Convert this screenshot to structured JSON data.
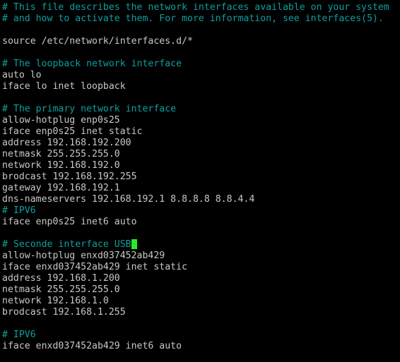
{
  "terminal": {
    "background_color": "#000000",
    "comment_color": "#0f9f9f",
    "text_color": "#c8c8c8",
    "cursor_color": "#22ee22",
    "filename_hint": "/etc/network/interfaces",
    "lines": [
      {
        "text": "# This file describes the network interfaces available on your system",
        "kind": "comment"
      },
      {
        "text": "# and how to activate them. For more information, see interfaces(5).",
        "kind": "comment"
      },
      {
        "text": "",
        "kind": "blank"
      },
      {
        "text": "source /etc/network/interfaces.d/*",
        "kind": "plain"
      },
      {
        "text": "",
        "kind": "blank"
      },
      {
        "text": "# The loopback network interface",
        "kind": "comment"
      },
      {
        "text": "auto lo",
        "kind": "plain"
      },
      {
        "text": "iface lo inet loopback",
        "kind": "plain"
      },
      {
        "text": "",
        "kind": "blank"
      },
      {
        "text": "# The primary network interface",
        "kind": "comment"
      },
      {
        "text": "allow-hotplug enp0s25",
        "kind": "plain"
      },
      {
        "text": "iface enp0s25 inet static",
        "kind": "plain"
      },
      {
        "text": "address 192.168.192.200",
        "kind": "plain"
      },
      {
        "text": "netmask 255.255.255.0",
        "kind": "plain"
      },
      {
        "text": "network 192.168.192.0",
        "kind": "plain"
      },
      {
        "text": "brodcast 192.168.192.255",
        "kind": "plain"
      },
      {
        "text": "gateway 192.168.192.1",
        "kind": "plain"
      },
      {
        "text": "dns-nameservers 192.168.192.1 8.8.8.8 8.8.4.4",
        "kind": "plain"
      },
      {
        "text": "# IPV6",
        "kind": "comment"
      },
      {
        "text": "iface enp0s25 inet6 auto",
        "kind": "plain"
      },
      {
        "text": "",
        "kind": "blank"
      },
      {
        "text": "# Seconde interface USB",
        "kind": "comment",
        "cursor_after": true
      },
      {
        "text": "allow-hotplug enxd037452ab429",
        "kind": "plain"
      },
      {
        "text": "iface enxd037452ab429 inet static",
        "kind": "plain"
      },
      {
        "text": "address 192.168.1.200",
        "kind": "plain"
      },
      {
        "text": "netmask 255.255.255.0",
        "kind": "plain"
      },
      {
        "text": "network 192.168.1.0",
        "kind": "plain"
      },
      {
        "text": "brodcast 192.168.1.255",
        "kind": "plain"
      },
      {
        "text": "",
        "kind": "blank"
      },
      {
        "text": "# IPV6",
        "kind": "comment"
      },
      {
        "text": "iface enxd037452ab429 inet6 auto",
        "kind": "plain"
      }
    ]
  }
}
